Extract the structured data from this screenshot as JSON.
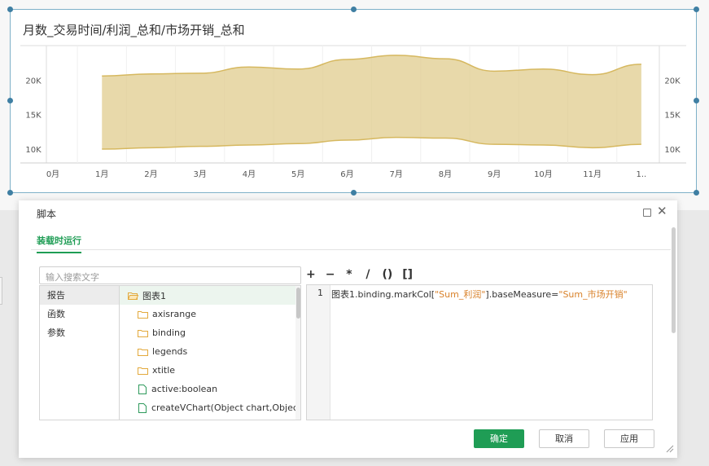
{
  "chart_data": {
    "type": "area",
    "title": "月数_交易时间/利润_总和/市场开销_总和",
    "categories": [
      "0月",
      "1月",
      "2月",
      "3月",
      "4月",
      "5月",
      "6月",
      "7月",
      "8月",
      "9月",
      "10月",
      "11月",
      "1.."
    ],
    "y_ticks": [
      "20K",
      "15K",
      "10K"
    ],
    "y2_ticks": [
      "20K",
      "15K",
      "10K"
    ],
    "series": [
      {
        "band": "upper",
        "values": [
          null,
          20600,
          20900,
          21000,
          21900,
          21600,
          23000,
          23600,
          23100,
          21300,
          21600,
          20800,
          22300
        ]
      },
      {
        "band": "lower",
        "values": [
          null,
          10000,
          10200,
          10400,
          10600,
          10800,
          11300,
          11700,
          11600,
          10700,
          10600,
          10200,
          10700
        ]
      }
    ],
    "ylim": [
      8000,
      25000
    ],
    "fill_color": "#e0cc8e",
    "line_color": "#d6b85f"
  },
  "dialog": {
    "title": "脚本",
    "tab": "装载时运行",
    "search_placeholder": "输入搜索文字",
    "operators": [
      "+",
      "−",
      "*",
      "/",
      "()",
      "[]"
    ],
    "categories": [
      "报告",
      "函数",
      "参数"
    ],
    "tree": {
      "root": "图表1",
      "folders": [
        "axisrange",
        "binding",
        "legends",
        "xtitle"
      ],
      "members": [
        "active:boolean",
        "createVChart(Object chart,Object grid"
      ]
    },
    "editor": {
      "line_number": "1",
      "code_prefix": "图表1.binding.markCol[",
      "code_str1": "\"Sum_利润\"",
      "code_mid": "].baseMeasure=",
      "code_str2": "\"Sum_市场开销\""
    },
    "buttons": {
      "ok": "确定",
      "cancel": "取消",
      "apply": "应用"
    }
  },
  "colors": {
    "accent": "#1f9d55",
    "selection_border": "#7eb0c8"
  }
}
